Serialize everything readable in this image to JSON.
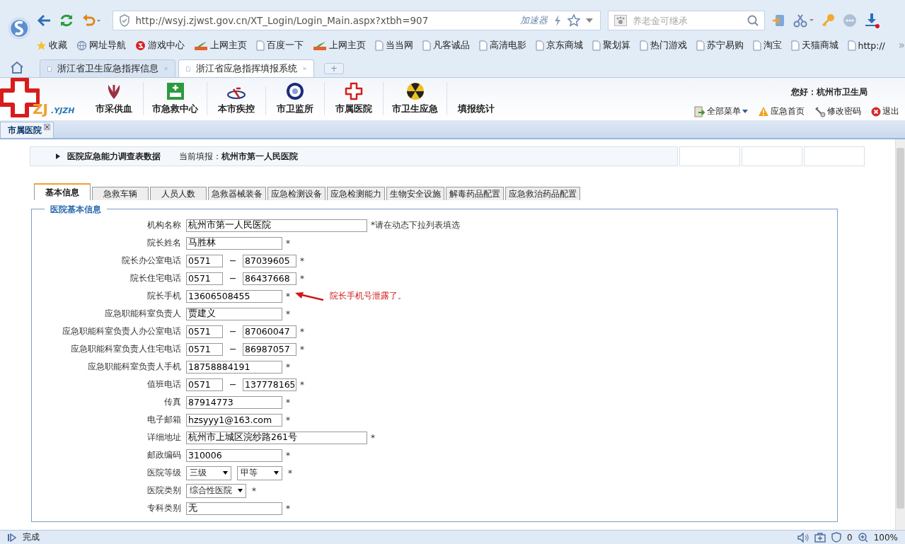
{
  "browser": {
    "address": "http://wsyj.zjwst.gov.cn/XT_Login/Login_Main.aspx?xtbh=907",
    "accelerator": "加速器",
    "search": {
      "placeholder": "养老金可继承"
    },
    "bookmarks": [
      {
        "label": "收藏",
        "kind": "star"
      },
      {
        "label": "网址导航",
        "kind": "globe"
      },
      {
        "label": "游戏中心",
        "kind": "game"
      },
      {
        "label": "上网主页",
        "kind": "hao"
      },
      {
        "label": "百度一下",
        "kind": "page"
      },
      {
        "label": "上网主页",
        "kind": "hao"
      },
      {
        "label": "当当网",
        "kind": "page"
      },
      {
        "label": "凡客诚品",
        "kind": "page"
      },
      {
        "label": "高清电影",
        "kind": "page"
      },
      {
        "label": "京东商城",
        "kind": "page"
      },
      {
        "label": "聚划算",
        "kind": "page"
      },
      {
        "label": "热门游戏",
        "kind": "page"
      },
      {
        "label": "苏宁易购",
        "kind": "page"
      },
      {
        "label": "淘宝",
        "kind": "page"
      },
      {
        "label": "天猫商城",
        "kind": "page"
      },
      {
        "label": "http://",
        "kind": "page"
      }
    ],
    "more": "»",
    "tabs": [
      {
        "title": "浙江省卫生应急指挥信息",
        "selected": false
      },
      {
        "title": "浙江省应急指挥填报系统",
        "selected": true
      }
    ],
    "new_tab": "+"
  },
  "app": {
    "logo": "ZJ",
    "logo_sub": ".YJZH",
    "nav": [
      {
        "label": "市采供血",
        "kind": "blood"
      },
      {
        "label": "市急救中心",
        "kind": "ambulance"
      },
      {
        "label": "本市疾控",
        "kind": "disease"
      },
      {
        "label": "市卫监所",
        "kind": "badge"
      },
      {
        "label": "市属医院",
        "kind": "cross"
      },
      {
        "label": "市卫生应急",
        "kind": "radiation"
      },
      {
        "label": "填报统计",
        "kind": "plain"
      }
    ],
    "greeting": "您好：杭州市卫生局",
    "toolbar": [
      {
        "label": "全部菜单",
        "kind": "menu"
      },
      {
        "label": "应急首页",
        "kind": "home"
      },
      {
        "label": "修改密码",
        "kind": "password"
      },
      {
        "label": "退出",
        "kind": "exit"
      }
    ],
    "page_tab": "市属医院"
  },
  "breadcrumb": {
    "title": "医院应急能力调查表数据",
    "current": "当前填报：**杭州市第一人民医院**"
  },
  "form_tabs": [
    {
      "label": "基本信息",
      "selected": true
    },
    {
      "label": "急救车辆",
      "selected": false
    },
    {
      "label": "人员人数",
      "selected": false
    },
    {
      "label": "急救器械装备",
      "selected": false
    },
    {
      "label": "应急检测设备",
      "selected": false
    },
    {
      "label": "应急检测能力",
      "selected": false
    },
    {
      "label": "生物安全设施",
      "selected": false
    },
    {
      "label": "解毒药品配置",
      "selected": false
    },
    {
      "label": "应急救治药品配置",
      "selected": false
    }
  ],
  "legend": "医院基本信息",
  "fields": [
    {
      "label": "机构名称",
      "kind": "wide",
      "value": "杭州市第一人民医院",
      "note": "*请在动态下拉列表填选"
    },
    {
      "label": "院长姓名",
      "kind": "text",
      "value": "马胜林",
      "note": "*"
    },
    {
      "label": "院长办公室电话",
      "kind": "phone",
      "area": "0571",
      "value": "87039605",
      "note": "*"
    },
    {
      "label": "院长住宅电话",
      "kind": "phone",
      "area": "0571",
      "value": "86437668",
      "note": "*"
    },
    {
      "label": "院长手机",
      "kind": "text",
      "value": "13606508455",
      "note": "*",
      "annotation": "院长手机号泄露了。"
    },
    {
      "label": "应急职能科室负责人",
      "kind": "text",
      "value": "贾建义",
      "note": "*"
    },
    {
      "label": "应急职能科室负责人办公室电话",
      "kind": "phone",
      "area": "0571",
      "value": "87060047",
      "note": "*"
    },
    {
      "label": "应急职能科室负责人住宅电话",
      "kind": "phone",
      "area": "0571",
      "value": "86987057",
      "note": "*"
    },
    {
      "label": "应急职能科室负责人手机",
      "kind": "text",
      "value": "18758884191",
      "note": "*"
    },
    {
      "label": "值班电话",
      "kind": "phone",
      "area": "0571",
      "value": "137778165",
      "note": "*"
    },
    {
      "label": "传真",
      "kind": "text",
      "value": "87914773",
      "note": "*"
    },
    {
      "label": "电子邮箱",
      "kind": "text",
      "value": "hzsyyy1@163.com",
      "note": "*"
    },
    {
      "label": "详细地址",
      "kind": "wide",
      "value": "杭州市上城区浣纱路261号",
      "note": "*"
    },
    {
      "label": "邮政编码",
      "kind": "text",
      "value": "310006",
      "note": "*"
    },
    {
      "label": "医院等级",
      "kind": "selects",
      "options": [
        "三级",
        "甲等"
      ],
      "note": "*"
    },
    {
      "label": "医院类别",
      "kind": "selects",
      "options": [
        "综合性医院"
      ],
      "note": "*"
    },
    {
      "label": "专科类别",
      "kind": "text",
      "value": "无",
      "note": "*"
    }
  ],
  "status_bar": {
    "text": "完成",
    "count": "0",
    "zoom": "100%"
  }
}
